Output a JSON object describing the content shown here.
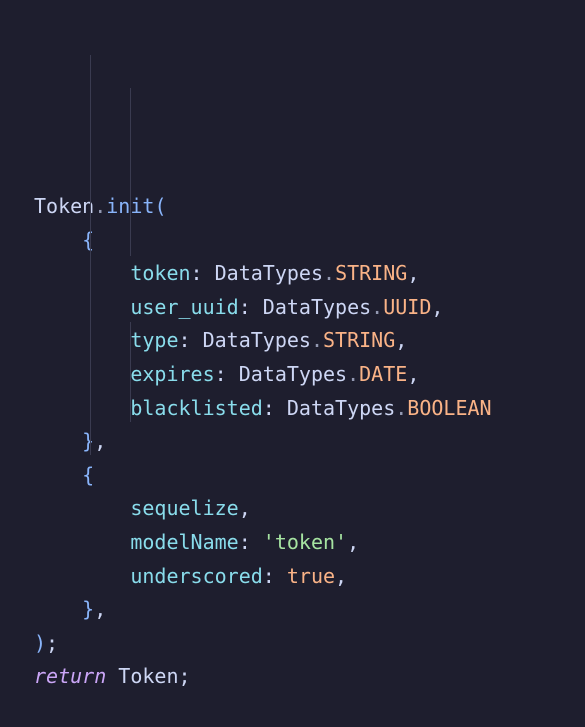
{
  "code": {
    "lines": [
      [
        {
          "t": "Token",
          "c": "plain"
        },
        {
          "t": ".",
          "c": "punct"
        },
        {
          "t": "init",
          "c": "func"
        },
        {
          "t": "(",
          "c": "paren"
        }
      ],
      [
        {
          "t": "    ",
          "c": "plain"
        },
        {
          "t": "{",
          "c": "brace"
        }
      ],
      [
        {
          "t": "        ",
          "c": "plain"
        },
        {
          "t": "token",
          "c": "prop"
        },
        {
          "t": ": ",
          "c": "plain"
        },
        {
          "t": "DataTypes",
          "c": "plain"
        },
        {
          "t": ".",
          "c": "punct"
        },
        {
          "t": "STRING",
          "c": "const"
        },
        {
          "t": ",",
          "c": "plain"
        }
      ],
      [
        {
          "t": "        ",
          "c": "plain"
        },
        {
          "t": "user_uuid",
          "c": "prop"
        },
        {
          "t": ": ",
          "c": "plain"
        },
        {
          "t": "DataTypes",
          "c": "plain"
        },
        {
          "t": ".",
          "c": "punct"
        },
        {
          "t": "UUID",
          "c": "const"
        },
        {
          "t": ",",
          "c": "plain"
        }
      ],
      [
        {
          "t": "        ",
          "c": "plain"
        },
        {
          "t": "type",
          "c": "prop"
        },
        {
          "t": ": ",
          "c": "plain"
        },
        {
          "t": "DataTypes",
          "c": "plain"
        },
        {
          "t": ".",
          "c": "punct"
        },
        {
          "t": "STRING",
          "c": "const"
        },
        {
          "t": ",",
          "c": "plain"
        }
      ],
      [
        {
          "t": "        ",
          "c": "plain"
        },
        {
          "t": "expires",
          "c": "prop"
        },
        {
          "t": ": ",
          "c": "plain"
        },
        {
          "t": "DataTypes",
          "c": "plain"
        },
        {
          "t": ".",
          "c": "punct"
        },
        {
          "t": "DATE",
          "c": "const"
        },
        {
          "t": ",",
          "c": "plain"
        }
      ],
      [
        {
          "t": "        ",
          "c": "plain"
        },
        {
          "t": "blacklisted",
          "c": "prop"
        },
        {
          "t": ": ",
          "c": "plain"
        },
        {
          "t": "DataTypes",
          "c": "plain"
        },
        {
          "t": ".",
          "c": "punct"
        },
        {
          "t": "BOOLEAN",
          "c": "const"
        }
      ],
      [
        {
          "t": "    ",
          "c": "plain"
        },
        {
          "t": "}",
          "c": "brace"
        },
        {
          "t": ",",
          "c": "plain"
        }
      ],
      [
        {
          "t": "    ",
          "c": "plain"
        },
        {
          "t": "{",
          "c": "brace"
        }
      ],
      [
        {
          "t": "        ",
          "c": "plain"
        },
        {
          "t": "sequelize",
          "c": "prop"
        },
        {
          "t": ",",
          "c": "plain"
        }
      ],
      [
        {
          "t": "        ",
          "c": "plain"
        },
        {
          "t": "modelName",
          "c": "prop"
        },
        {
          "t": ": ",
          "c": "plain"
        },
        {
          "t": "'token'",
          "c": "string"
        },
        {
          "t": ",",
          "c": "plain"
        }
      ],
      [
        {
          "t": "        ",
          "c": "plain"
        },
        {
          "t": "underscored",
          "c": "prop"
        },
        {
          "t": ": ",
          "c": "plain"
        },
        {
          "t": "true",
          "c": "bool"
        },
        {
          "t": ",",
          "c": "plain"
        }
      ],
      [
        {
          "t": "    ",
          "c": "plain"
        },
        {
          "t": "}",
          "c": "brace"
        },
        {
          "t": ",",
          "c": "plain"
        }
      ],
      [
        {
          "t": ")",
          "c": "paren"
        },
        {
          "t": ";",
          "c": "plain"
        }
      ],
      [
        {
          "t": "return",
          "c": "kw"
        },
        {
          "t": " Token",
          "c": "plain"
        },
        {
          "t": ";",
          "c": "plain"
        }
      ]
    ]
  },
  "colors": {
    "background": "#1e1e2e",
    "text": "#cdd6f4",
    "function": "#89b4fa",
    "property": "#89dceb",
    "constant": "#fab387",
    "string": "#a6e3a1",
    "keyword": "#cba6f7"
  }
}
